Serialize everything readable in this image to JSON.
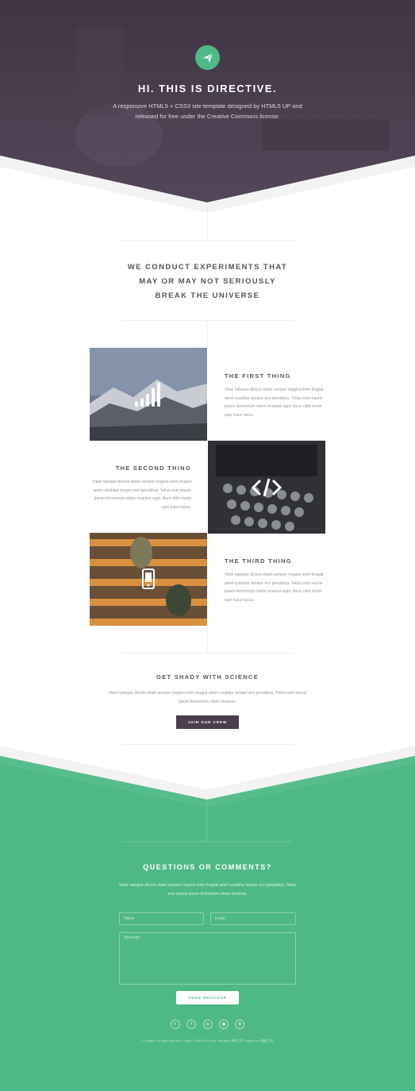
{
  "colors": {
    "header": "#4a3e4c",
    "accent": "#4fb985",
    "button_dark": "#4a3e4c"
  },
  "header": {
    "logo_icon": "paper-plane-icon",
    "title": "HI. THIS IS DIRECTIVE.",
    "subtitle": "A responsive HTML5 + CSS3 site template designed by HTML5 UP and released for free under the Creative Commons license."
  },
  "intro": {
    "heading_line1": "WE CONDUCT EXPERIMENTS THAT",
    "heading_line2": "MAY OR MAY NOT SERIOUSLY",
    "heading_line3": "BREAK THE UNIVERSE"
  },
  "features": [
    {
      "title": "THE FIRST THING",
      "icon": "bar-chart-icon",
      "text": "Vitae natoque dictum etiam semper magnis enim feugiat amet curabitur tempor orci penatibus. Tellus erat mauris ipsum fermentum etiam vivamus eget. Nunc nibh morbi quis fusce lacus."
    },
    {
      "title": "THE SECOND THING",
      "icon": "code-icon",
      "text": "Vitae natoque dictum etiam semper magnis enim feugiat amet curabitur tempor orci penatibus. Tellus erat mauris ipsum fermentum etiam vivamus eget. Nunc nibh morbi quis fusce lacus."
    },
    {
      "title": "THE THIRD THING",
      "icon": "mobile-icon",
      "text": "Vitae natoque dictum etiam semper magnis enim feugiat amet curabitur tempor orci penatibus. Tellus erat mauris ipsum fermentum etiam vivamus eget. Nunc nibh morbi quis fusce lacus."
    }
  ],
  "cta": {
    "title": "GET SHADY WITH SCIENCE",
    "text": "Vitae natoque dictum etiam semper magnis enim feugiat amet curabitur tempor orci penatibus. Tellus erat mauris ipsum fermentum etiam vivamus.",
    "button": "JOIN OUR CREW"
  },
  "contact": {
    "title": "QUESTIONS OR COMMENTS?",
    "text": "Vitae natoque dictum etiam semper magnis enim feugiat amet curabitur tempor orci penatibus. Tellus erat mauris ipsum fermentum etiam vivamus.",
    "name_placeholder": "Name",
    "email_placeholder": "Email",
    "message_placeholder": "Message",
    "send": "SEND MESSAGE"
  },
  "socials": [
    {
      "icon": "twitter-icon",
      "glyph": "t"
    },
    {
      "icon": "facebook-icon",
      "glyph": "f"
    },
    {
      "icon": "instagram-icon",
      "glyph": "◎"
    },
    {
      "icon": "github-icon",
      "glyph": "●"
    },
    {
      "icon": "dribbble-icon",
      "glyph": "⊛"
    }
  ],
  "copyright": "© Untitled. All rights reserved.   Design: HTML5 UP  More Templates 模板之家  Collect from 模板之家"
}
